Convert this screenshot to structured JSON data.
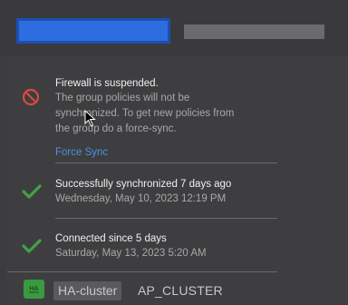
{
  "firewall": {
    "title": "Firewall is suspended.",
    "lines": [
      "The group policies will not be",
      "synchronized. To get new policies from",
      "the group do a force-sync."
    ],
    "link": "Force Sync",
    "icon": "blocked-icon",
    "color": "#d9493f"
  },
  "sync": {
    "title": "Successfully synchronized 7 days ago",
    "subtitle": "Wednesday, May 10, 2023 12:19 PM",
    "icon": "check-icon",
    "color": "#44a047"
  },
  "connection": {
    "title": "Connected since 5 days",
    "subtitle": "Saturday, May 13, 2023 5:20 AM",
    "icon": "check-icon",
    "color": "#44a047"
  },
  "cluster": {
    "type": "HA-cluster",
    "name": "AP_CLUSTER",
    "badge_text": "HA",
    "badge_color": "#3a9a3f"
  }
}
